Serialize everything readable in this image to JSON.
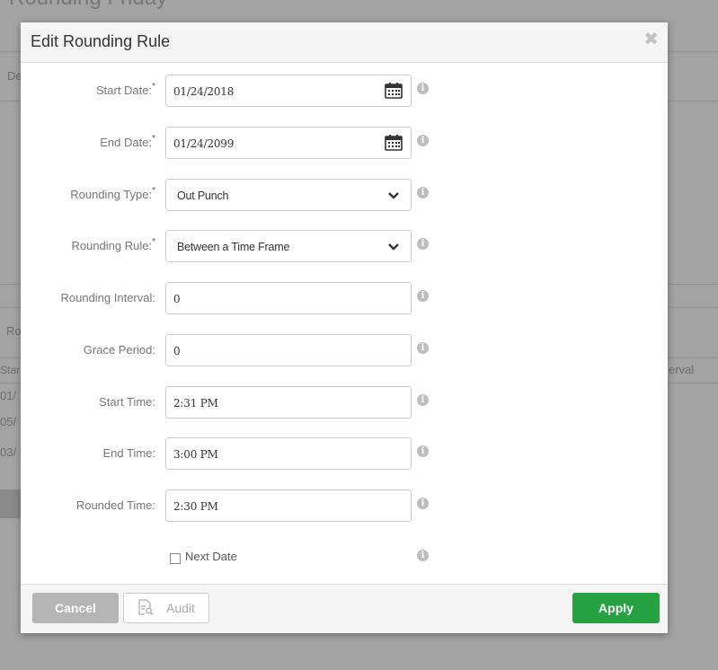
{
  "background": {
    "page_title": "Rounding Friday",
    "fragments": [
      "De",
      "Ro",
      "Star",
      "01/",
      "05/",
      "03/",
      "erval"
    ]
  },
  "modal": {
    "title": "Edit Rounding Rule",
    "close_icon": "close-icon",
    "fields": [
      {
        "label": "Start Date:",
        "required": "*",
        "value": "01/24/2018",
        "type": "date"
      },
      {
        "label": "End Date:",
        "required": "*",
        "value": "01/24/2099",
        "type": "date"
      },
      {
        "label": "Rounding Type:",
        "required": "*",
        "value": "Out Punch",
        "type": "select"
      },
      {
        "label": "Rounding Rule:",
        "required": "*",
        "value": "Between a Time Frame",
        "type": "select"
      },
      {
        "label": "Rounding Interval:",
        "required": "",
        "value": "0",
        "type": "text"
      },
      {
        "label": "Grace Period:",
        "required": "",
        "value": "0",
        "type": "text"
      },
      {
        "label": "Start Time:",
        "required": "",
        "value": "2:31 PM",
        "type": "text"
      },
      {
        "label": "End Time:",
        "required": "",
        "value": "3:00 PM",
        "type": "text"
      },
      {
        "label": "Rounded Time:",
        "required": "",
        "value": "2:30 PM",
        "type": "text"
      }
    ],
    "next_date": {
      "label": "Next Date",
      "checked": false
    },
    "info_glyph": "i"
  },
  "footer": {
    "cancel_label": "Cancel",
    "audit_label": "Audit",
    "apply_label": "Apply"
  },
  "colors": {
    "apply": "#27a243",
    "cancel": "#b5b5b5",
    "overlay": "#a3a3a3"
  }
}
